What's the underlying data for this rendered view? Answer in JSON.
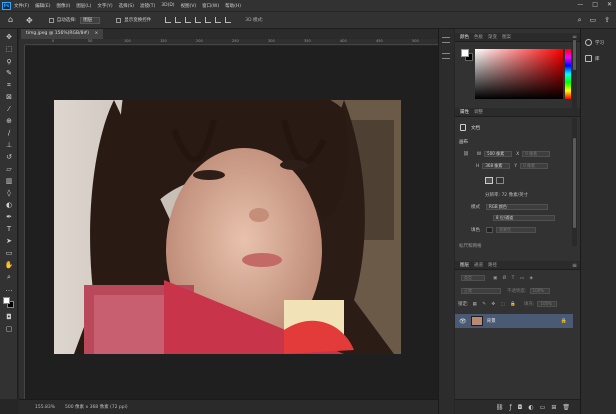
{
  "menubar": {
    "logo": "Ps",
    "items": [
      "文件(F)",
      "编辑(E)",
      "图像(I)",
      "图层(L)",
      "文字(Y)",
      "选择(S)",
      "滤镜(T)",
      "3D(D)",
      "视图(V)",
      "窗口(W)",
      "帮助(H)"
    ],
    "win_min": "—",
    "win_max": "□",
    "win_close": "✕"
  },
  "options_bar": {
    "home_icon": "home-icon",
    "move_icon": "move-tool-icon",
    "auto_select_label": "自动选择:",
    "auto_select_value": "图层",
    "show_transform_label": "显示变换控件",
    "mode_3d_label": "3D 模式:"
  },
  "document": {
    "tab_title": "timg.jpeg @ 156%(RGB/8#)",
    "tab_close": "×",
    "ruler_ticks": [
      "0",
      "50",
      "100",
      "150",
      "200",
      "250",
      "300",
      "350",
      "400",
      "450",
      "500",
      "550",
      "600",
      "650",
      "700",
      "750",
      "800",
      "850",
      "900",
      "950"
    ]
  },
  "status_bar": {
    "zoom": "155.83%",
    "doc_info": "500 像素 x 368 像素 (72 ppi)"
  },
  "color_panel": {
    "tabs": [
      "颜色",
      "色板",
      "渐变",
      "图案"
    ],
    "foreground": "#ffffff",
    "background": "#000000"
  },
  "properties_panel": {
    "tabs": [
      "属性",
      "调整"
    ],
    "doc_label": "文档",
    "canvas_title": "画布",
    "width_label": "W",
    "width_value": "500 像素",
    "x_label": "X",
    "x_placeholder": "0 像素",
    "height_label": "H",
    "height_value": "368 像素",
    "y_label": "Y",
    "y_placeholder": "0 像素",
    "resolution_text": "分辨率: 72 像素/英寸",
    "mode_label": "模式",
    "mode_value": "RGB 颜色",
    "depth_value": "8 位/通道",
    "fill_label": "填色",
    "fill_value": "背景色",
    "rulers_title": "标尺和网格"
  },
  "layers_panel": {
    "tabs": [
      "图层",
      "通道",
      "路径"
    ],
    "search_placeholder": "类型",
    "blend_mode": "正常",
    "opacity_label": "不透明度:",
    "opacity_value": "100%",
    "lock_label": "锁定:",
    "fill_label": "填充:",
    "fill_value": "100%",
    "layer_name": "背景",
    "footer_icons": [
      "link-icon",
      "fx-icon",
      "mask-icon",
      "adjustment-icon",
      "group-icon",
      "new-layer-icon",
      "trash-icon"
    ]
  },
  "far_right_panel": {
    "learn_label": "学习",
    "libraries_label": "库"
  },
  "colors": {
    "accent": "#31a8ff",
    "selected_layer": "#4a5a74"
  }
}
